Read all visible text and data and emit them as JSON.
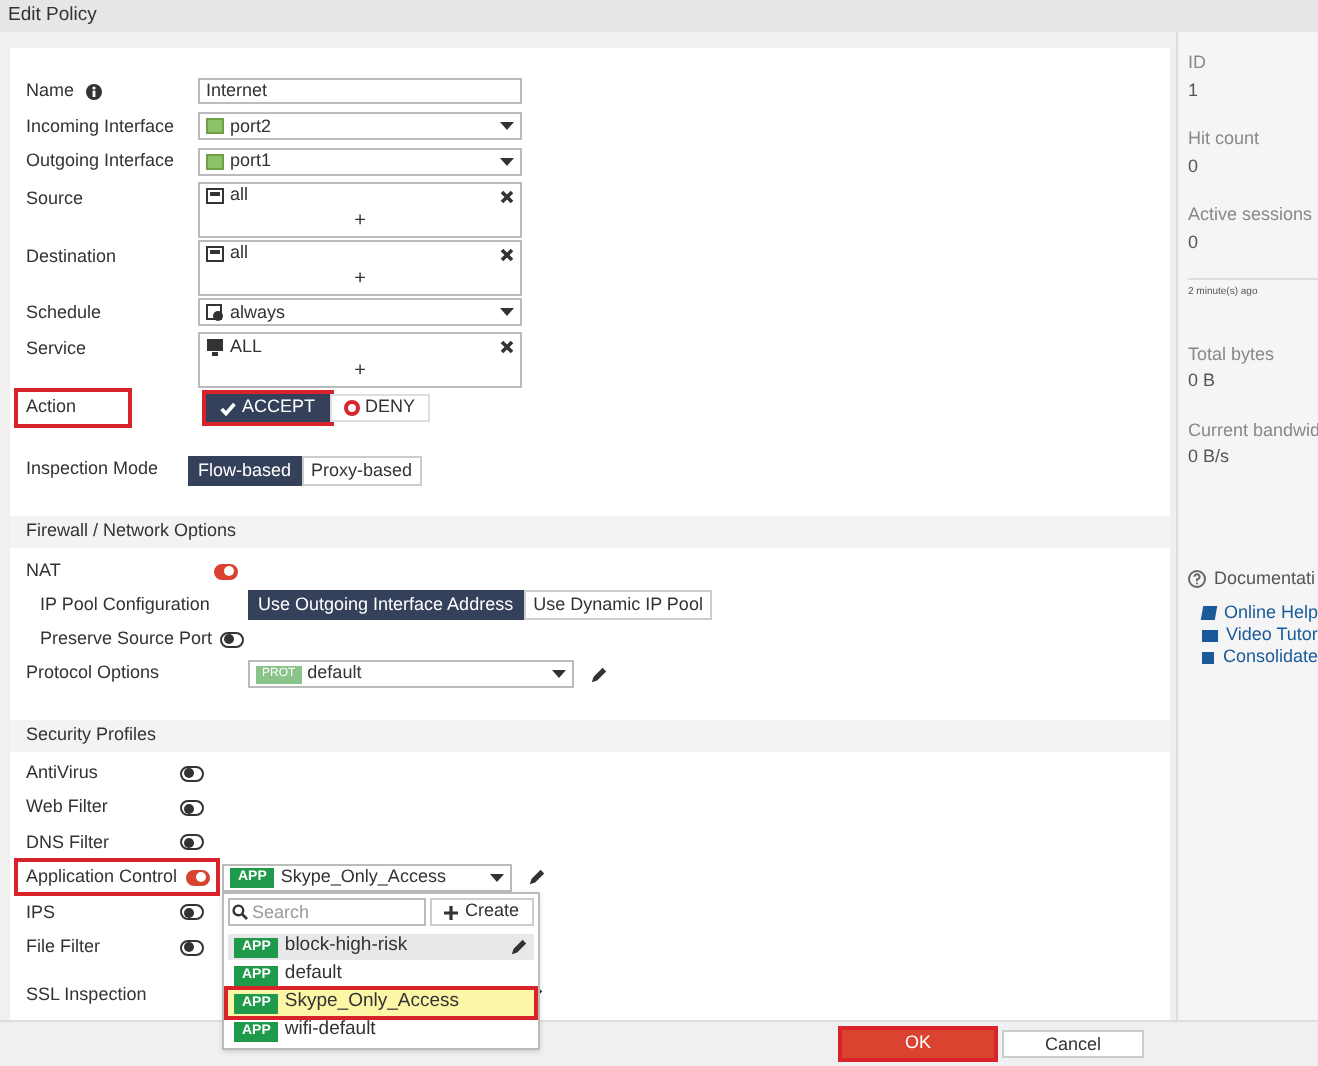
{
  "window": {
    "title": "Edit Policy"
  },
  "fields": [
    {
      "kind": "text",
      "label": "Name",
      "info": true,
      "value": "Internet"
    },
    {
      "kind": "interface",
      "label": "Incoming Interface",
      "value": "port2"
    },
    {
      "kind": "interface",
      "label": "Outgoing Interface",
      "value": "port1"
    },
    {
      "kind": "address",
      "label": "Source",
      "value": "all",
      "add": "+"
    },
    {
      "kind": "address",
      "label": "Destination",
      "value": "all",
      "add": "+"
    },
    {
      "kind": "schedule",
      "label": "Schedule",
      "value": "always"
    },
    {
      "kind": "service",
      "label": "Service",
      "value": "ALL",
      "add": "+"
    }
  ],
  "action": {
    "label": "Action",
    "highlighted": true,
    "options": [
      {
        "label": "ACCEPT",
        "selected": true,
        "highlighted": true
      },
      {
        "label": "DENY",
        "selected": false,
        "highlighted": false
      }
    ]
  },
  "inspection": {
    "label": "Inspection Mode",
    "options": [
      {
        "label": "Flow-based",
        "selected": true
      },
      {
        "label": "Proxy-based",
        "selected": false
      }
    ]
  },
  "firewall": {
    "title": "Firewall / Network Options",
    "nat": {
      "label": "NAT",
      "on": true
    },
    "ip_pool": {
      "label": "IP Pool Configuration",
      "options": [
        {
          "label": "Use Outgoing Interface Address",
          "selected": true
        },
        {
          "label": "Use Dynamic IP Pool",
          "selected": false
        }
      ]
    },
    "preserve": {
      "label": "Preserve Source Port",
      "on": false
    },
    "protocol": {
      "label": "Protocol Options",
      "tag": "PROT",
      "value": "default"
    }
  },
  "security": {
    "title": "Security Profiles",
    "profiles": [
      {
        "kind": "toggle",
        "label": "AntiVirus",
        "on": false,
        "highlighted": false
      },
      {
        "kind": "toggle",
        "label": "Web Filter",
        "on": false,
        "highlighted": false
      },
      {
        "kind": "toggle",
        "label": "DNS Filter",
        "on": false,
        "highlighted": false
      },
      {
        "kind": "toggle",
        "label": "Application Control",
        "on": true,
        "highlighted": true,
        "tag": "APP",
        "value": "Skype_Only_Access"
      },
      {
        "kind": "toggle",
        "label": "IPS",
        "on": false,
        "highlighted": false
      },
      {
        "kind": "toggle",
        "label": "File Filter",
        "on": false,
        "highlighted": false
      },
      {
        "kind": "plain",
        "label": "SSL Inspection"
      }
    ]
  },
  "dropdown": {
    "search_placeholder": "Search",
    "create": "Create",
    "options": [
      {
        "tag": "APP",
        "label": "block-high-risk",
        "selected": false,
        "hovered": true,
        "highlighted": false
      },
      {
        "tag": "APP",
        "label": "default",
        "selected": false,
        "hovered": false,
        "highlighted": false
      },
      {
        "tag": "APP",
        "label": "Skype_Only_Access",
        "selected": true,
        "hovered": false,
        "highlighted": true
      },
      {
        "tag": "APP",
        "label": "wifi-default",
        "selected": false,
        "hovered": false,
        "highlighted": false
      }
    ]
  },
  "sidebar": {
    "stats": [
      {
        "label": "ID",
        "value": "1"
      },
      {
        "label": "Hit count",
        "value": "0"
      },
      {
        "label": "Active sessions",
        "value": "0"
      }
    ],
    "updated": "2 minute(s) ago",
    "stats2": [
      {
        "label": "Total bytes",
        "value": "0 B"
      },
      {
        "label": "Current bandwid",
        "value": "0 B/s"
      }
    ],
    "docs_title": "Documentati",
    "links": [
      {
        "kind": "book",
        "label": "Online Help"
      },
      {
        "kind": "video",
        "label": "Video Tutor"
      },
      {
        "kind": "video",
        "label": "Consolidate"
      }
    ]
  },
  "footer": {
    "buttons": [
      {
        "kind": "primary",
        "label": "OK",
        "highlighted": true
      },
      {
        "kind": "secondary",
        "label": "Cancel",
        "highlighted": false
      }
    ]
  }
}
